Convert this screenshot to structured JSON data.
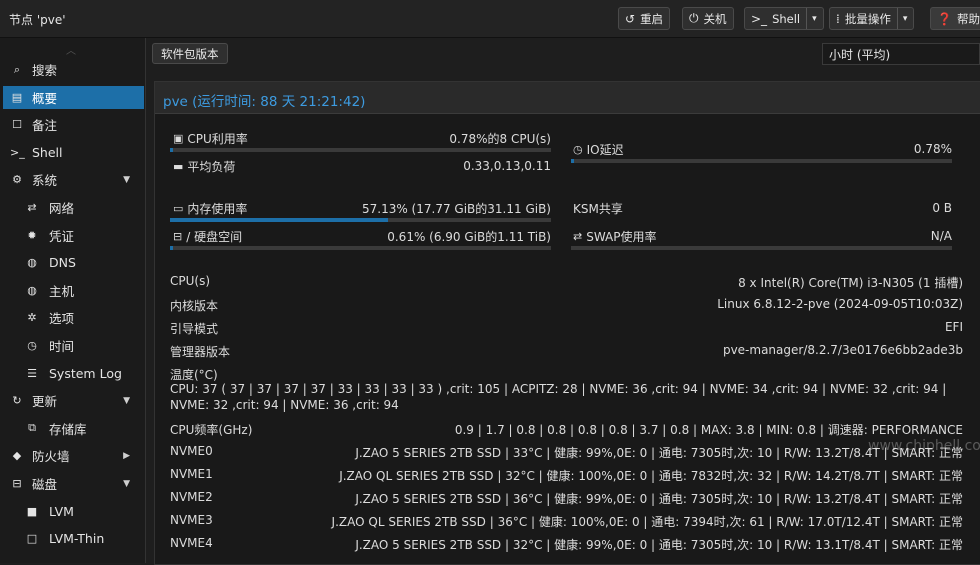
{
  "header": {
    "title": "节点 'pve'",
    "buttons": {
      "reboot": "重启",
      "shutdown": "关机",
      "shell": "Shell",
      "bulk": "批量操作",
      "help": "帮助"
    }
  },
  "sidebar": {
    "items": [
      {
        "icon": "search-icon",
        "glyph": "⌕",
        "label": "搜索"
      },
      {
        "icon": "book-icon",
        "glyph": "▤",
        "label": "概要"
      },
      {
        "icon": "note-icon",
        "glyph": "☐",
        "label": "备注"
      },
      {
        "icon": "terminal-icon",
        "glyph": ">_",
        "label": "Shell"
      },
      {
        "icon": "gears-icon",
        "glyph": "⚙",
        "label": "系统"
      },
      {
        "icon": "network-icon",
        "glyph": "⇄",
        "label": "网络"
      },
      {
        "icon": "certificate-icon",
        "glyph": "✹",
        "label": "凭证"
      },
      {
        "icon": "globe-icon",
        "glyph": "◍",
        "label": "DNS"
      },
      {
        "icon": "globe-icon",
        "glyph": "◍",
        "label": "主机"
      },
      {
        "icon": "gear-icon",
        "glyph": "✲",
        "label": "选项"
      },
      {
        "icon": "clock-icon",
        "glyph": "◷",
        "label": "时间"
      },
      {
        "icon": "list-icon",
        "glyph": "☰",
        "label": "System Log"
      },
      {
        "icon": "refresh-icon",
        "glyph": "↻",
        "label": "更新"
      },
      {
        "icon": "repository-icon",
        "glyph": "⧉",
        "label": "存储库"
      },
      {
        "icon": "shield-icon",
        "glyph": "◆",
        "label": "防火墙"
      },
      {
        "icon": "disk-icon",
        "glyph": "⊟",
        "label": "磁盘"
      },
      {
        "icon": "square-icon",
        "glyph": "■",
        "label": "LVM"
      },
      {
        "icon": "square-outline-icon",
        "glyph": "□",
        "label": "LVM-Thin"
      }
    ]
  },
  "toolbar": {
    "package_versions": "软件包版本",
    "timeframe": "小时 (平均)"
  },
  "summary": {
    "title": "pve (运行时间: 88 天 21:21:42)",
    "cpu_label": "CPU利用率",
    "cpu_value": "0.78%的8 CPU(s)",
    "cpu_fraction": 0.0078,
    "load_label": "平均负荷",
    "load_value": "0.33,0.13,0.11",
    "io_label": "IO延迟",
    "io_value": "0.78%",
    "io_fraction": 0.0078,
    "mem_label": "内存使用率",
    "mem_value": "57.13% (17.77 GiB的31.11 GiB)",
    "mem_fraction": 0.5713,
    "ksm_label": "KSM共享",
    "ksm_value": "0 B",
    "disk_label": "/ 硬盘空间",
    "disk_value": "0.61% (6.90 GiB的1.11 TiB)",
    "disk_fraction": 0.0061,
    "swap_label": "SWAP使用率",
    "swap_value": "N/A",
    "swap_fraction": 0.0
  },
  "details": {
    "cpus_label": "CPU(s)",
    "cpus_value": "8 x Intel(R) Core(TM) i3-N305 (1 插槽)",
    "kernel_label": "内核版本",
    "kernel_value": "Linux 6.8.12-2-pve (2024-09-05T10:03Z)",
    "boot_label": "引导模式",
    "boot_value": "EFI",
    "manager_label": "管理器版本",
    "manager_value": "pve-manager/8.2.7/3e0176e6bb2ade3b",
    "temp_label": "温度(°C)",
    "temp_value": "CPU: 37 ( 37 | 37 | 37 | 37 | 33 | 33 | 33 | 33 ) ,crit: 105 | ACPITZ: 28 | NVME: 36 ,crit: 94 | NVME: 34 ,crit: 94 | NVME: 32 ,crit: 94 | NVME: 32 ,crit: 94 | NVME: 36 ,crit: 94",
    "freq_label": "CPU频率(GHz)",
    "freq_value": "0.9 | 1.7 | 0.8 | 0.8 | 0.8 | 0.8 | 3.7 | 0.8 | MAX: 3.8 | MIN: 0.8 | 调速器: PERFORMANCE",
    "nvme": [
      {
        "label": "NVME0",
        "value": "J.ZAO 5 SERIES 2TB SSD | 33°C | 健康: 99%,0E: 0 | 通电: 7305时,次: 10 | R/W: 13.2T/8.4T | SMART: 正常"
      },
      {
        "label": "NVME1",
        "value": "J.ZAO QL SERIES 2TB SSD | 32°C | 健康: 100%,0E: 0 | 通电: 7832时,次: 32 | R/W: 14.2T/8.7T | SMART: 正常"
      },
      {
        "label": "NVME2",
        "value": "J.ZAO 5 SERIES 2TB SSD | 36°C | 健康: 99%,0E: 0 | 通电: 7305时,次: 10 | R/W: 13.2T/8.4T | SMART: 正常"
      },
      {
        "label": "NVME3",
        "value": "J.ZAO QL SERIES 2TB SSD | 36°C | 健康: 100%,0E: 0 | 通电: 7394时,次: 61 | R/W: 17.0T/12.4T | SMART: 正常"
      },
      {
        "label": "NVME4",
        "value": "J.ZAO 5 SERIES 2TB SSD | 32°C | 健康: 99%,0E: 0 | 通电: 7305时,次: 10 | R/W: 13.1T/8.4T | SMART: 正常"
      }
    ]
  },
  "watermark": "www.chiphell.com",
  "colors": {
    "accent": "#1d6fa8",
    "title_blue": "#3d9be0",
    "bar_track": "#3a3a3a"
  }
}
